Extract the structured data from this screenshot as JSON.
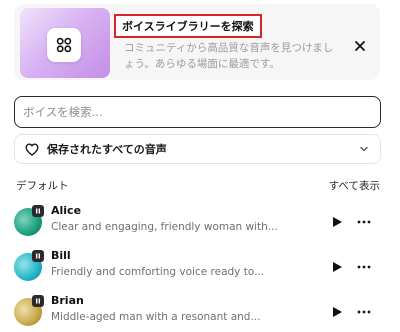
{
  "banner": {
    "title": "ボイスライブラリーを探索",
    "description": "コミュニティから高品質な音声を見つけましょう。あらゆる場面に最適です。",
    "icon": "grid-four-circles-icon",
    "close_icon": "close-icon",
    "highlight_color": "#d9262c"
  },
  "search": {
    "placeholder": "ボイスを検索...",
    "value": ""
  },
  "filter": {
    "label": "保存されたすべての音声",
    "icon": "heart-icon",
    "chevron": "chevron-down-icon"
  },
  "section": {
    "title": "デフォルト",
    "show_all": "すべて表示"
  },
  "voices": [
    {
      "name": "Alice",
      "description": "Clear and engaging, friendly woman with...",
      "avatar_colors": [
        "#1a9e7a",
        "#7fd3c0"
      ]
    },
    {
      "name": "Bill",
      "description": "Friendly and comforting voice ready to...",
      "avatar_colors": [
        "#1fb5c7",
        "#98e3ea"
      ]
    },
    {
      "name": "Brian",
      "description": "Middle-aged man with a resonant and...",
      "avatar_colors": [
        "#c9a64a",
        "#efe2a8"
      ]
    }
  ]
}
